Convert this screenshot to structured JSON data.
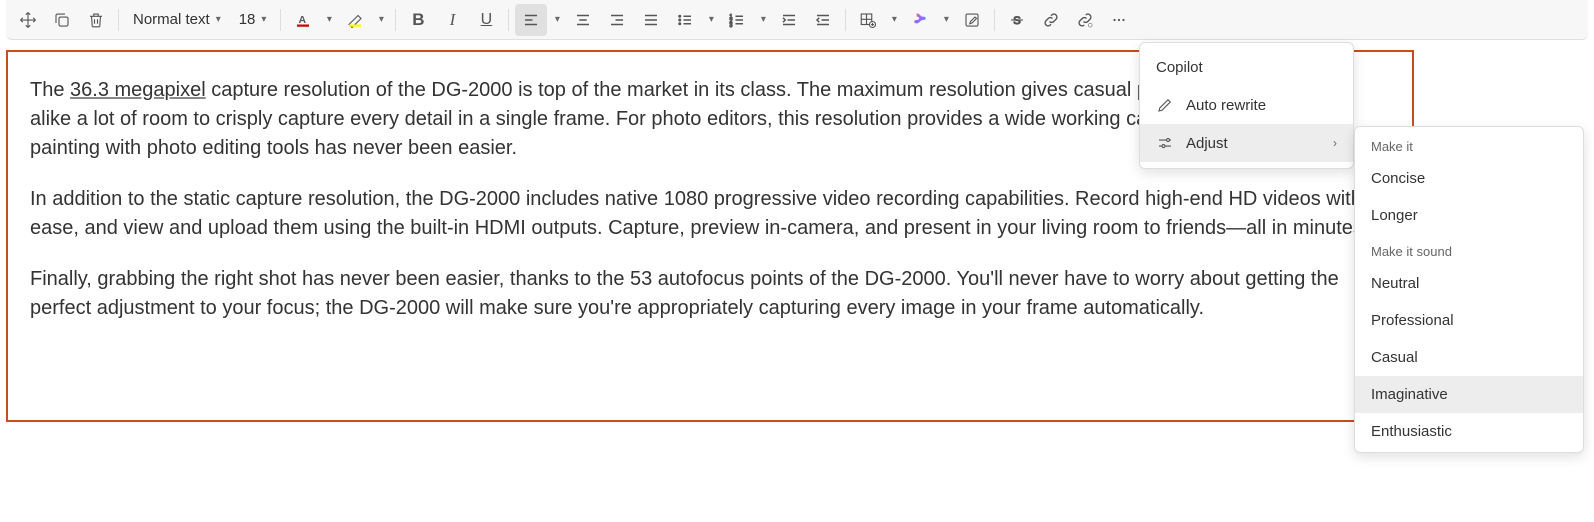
{
  "toolbar": {
    "style_select": "Normal text",
    "font_size": "18"
  },
  "document": {
    "paragraphs": [
      {
        "prefix": "The ",
        "underlined": "36.3 megapixel",
        "rest": " capture resolution of the DG-2000 is top of the market in its class. The maximum resolution gives casual photographers and pros alike a lot of room to crisply capture every detail in a single frame. For photo editors, this resolution provides a wide working canvas. Cropping, and painting with photo editing tools has never been easier."
      },
      {
        "text": "In addition to the static capture resolution, the DG-2000 includes native 1080 progressive video recording capabilities. Record high-end HD videos with ease, and view and upload them using the built-in HDMI outputs. Capture, preview in-camera, and present in your living room to friends—all in minutes."
      },
      {
        "text": "Finally, grabbing the right shot has never been easier, thanks to the 53 autofocus points of the DG-2000. You'll never have to worry about getting the perfect adjustment to your focus; the DG-2000 will make sure you're appropriately capturing every image in your frame automatically."
      }
    ]
  },
  "copilot_menu": {
    "title": "Copilot",
    "items": [
      {
        "label": "Auto rewrite",
        "icon": "pencil"
      },
      {
        "label": "Adjust",
        "icon": "sliders",
        "submenu": true
      }
    ]
  },
  "adjust_menu": {
    "header1": "Make it",
    "group1": [
      "Concise",
      "Longer"
    ],
    "header2": "Make it sound",
    "group2": [
      "Neutral",
      "Professional",
      "Casual",
      "Imaginative",
      "Enthusiastic"
    ],
    "hovered": "Imaginative"
  }
}
